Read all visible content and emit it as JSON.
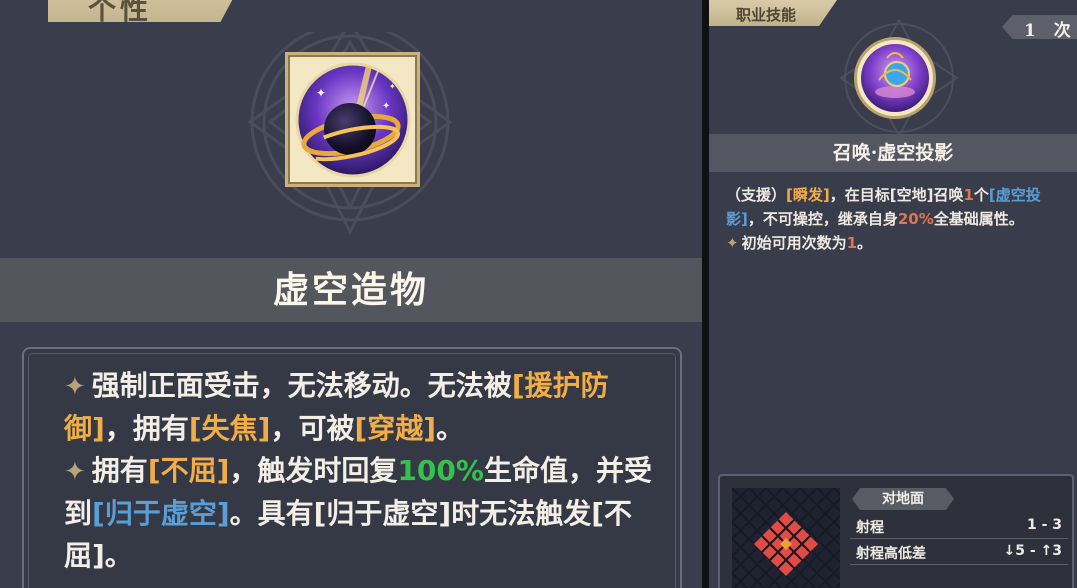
{
  "trait_panel": {
    "tab_label": "个性",
    "name": "虚空造物",
    "description": [
      [
        {
          "t": "强制正面受击，无法移动。无法被",
          "c": ""
        },
        {
          "t": "[援护防御]",
          "c": "orange-bracket"
        },
        {
          "t": "，拥有",
          "c": ""
        },
        {
          "t": "[失焦]",
          "c": "orange-bracket"
        },
        {
          "t": "，可被",
          "c": ""
        },
        {
          "t": "[穿越]",
          "c": "orange-bracket"
        },
        {
          "t": "。",
          "c": ""
        }
      ],
      [
        {
          "t": "拥有",
          "c": ""
        },
        {
          "t": "[不屈]",
          "c": "orange-bracket"
        },
        {
          "t": "，触发时回复",
          "c": ""
        },
        {
          "t": "100%",
          "c": "green"
        },
        {
          "t": "生命值，并受到",
          "c": ""
        },
        {
          "t": "[归于虚空]",
          "c": "blue-bracket"
        },
        {
          "t": "。具有[归于虚空]时无法触发[不屈]。",
          "c": ""
        }
      ]
    ]
  },
  "skill_panel": {
    "tab_label": "职业技能",
    "uses_count": "1 次",
    "name": "召唤·虚空投影",
    "description": [
      [
        {
          "t": "（支援）",
          "c": ""
        },
        {
          "t": "[瞬发]",
          "c": "orange-bracket"
        },
        {
          "t": "，在目标[空地]召唤",
          "c": ""
        },
        {
          "t": "1",
          "c": "red"
        },
        {
          "t": "个",
          "c": ""
        },
        {
          "t": "[虚空投影]",
          "c": "blue-bracket"
        },
        {
          "t": "，不可操控，继承自身",
          "c": ""
        },
        {
          "t": "20%",
          "c": "red"
        },
        {
          "t": "全基础属性。",
          "c": ""
        }
      ],
      [
        {
          "t": "初始可用次数为",
          "c": ""
        },
        {
          "t": "1",
          "c": "red"
        },
        {
          "t": "。",
          "c": ""
        }
      ]
    ],
    "range": {
      "tag": "对地面",
      "rows": [
        {
          "key": "射程",
          "value": "1 - 3"
        },
        {
          "key": "射程高低差",
          "value": "↓5 - ↑3"
        }
      ]
    }
  },
  "colors": {
    "panel_bg": "#3a3d4c",
    "band_bg": "#54565d",
    "highlight_orange": "#f1ad47",
    "highlight_green": "#35c24c",
    "highlight_blue": "#5a9ed6",
    "highlight_red": "#e4744a",
    "tab_gold": "#d8cba8"
  },
  "icons": {
    "trait_icon": "void-orb-icon",
    "skill_icon": "void-projection-icon",
    "bullet": "sparkle-icon"
  }
}
